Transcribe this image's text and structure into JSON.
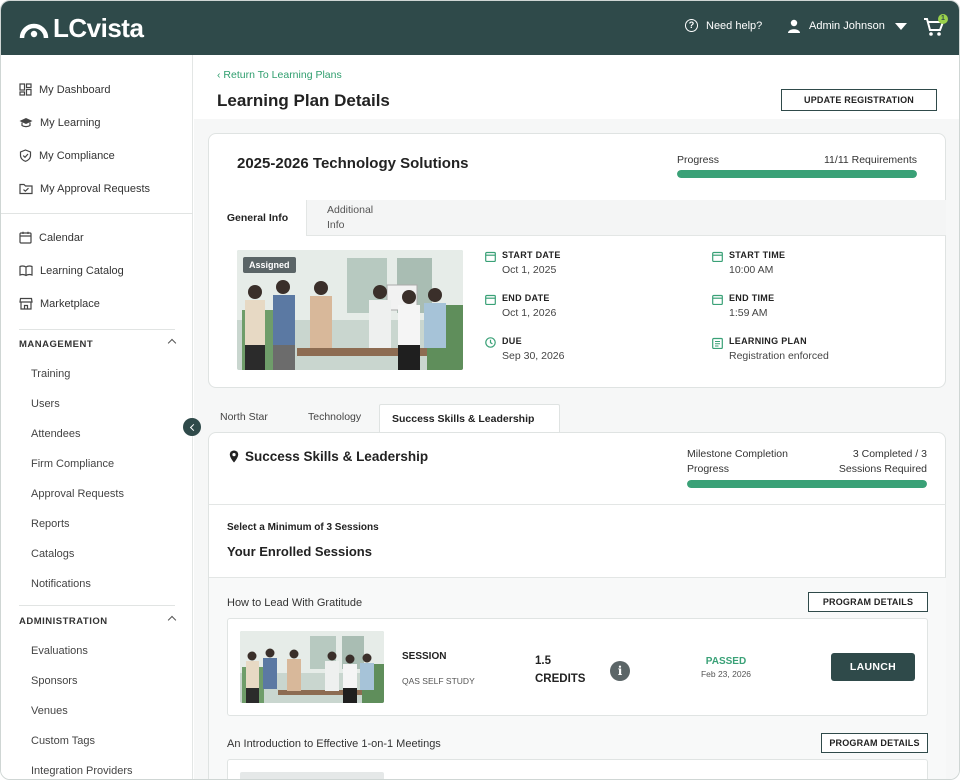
{
  "app": {
    "brand": "LCvista",
    "help_label": "Need help?",
    "user_name": "Admin Johnson",
    "cart_count": "1"
  },
  "sidebar": {
    "primary": [
      {
        "label": "My Dashboard",
        "icon": "dashboard-icon"
      },
      {
        "label": "My Learning",
        "icon": "graduation-cap-icon"
      },
      {
        "label": "My Compliance",
        "icon": "shield-check-icon"
      },
      {
        "label": "My Approval Requests",
        "icon": "folder-check-icon"
      }
    ],
    "secondary": [
      {
        "label": "Calendar",
        "icon": "calendar-icon"
      },
      {
        "label": "Learning Catalog",
        "icon": "book-open-icon"
      },
      {
        "label": "Marketplace",
        "icon": "store-icon"
      }
    ],
    "management": {
      "title": "MANAGEMENT",
      "items": [
        "Training",
        "Users",
        "Attendees",
        "Firm Compliance",
        "Approval Requests",
        "Reports",
        "Catalogs",
        "Notifications"
      ]
    },
    "administration": {
      "title": "ADMINISTRATION",
      "items": [
        "Evaluations",
        "Sponsors",
        "Venues",
        "Custom Tags",
        "Integration Providers"
      ]
    }
  },
  "page": {
    "back_link": "Return To Learning Plans",
    "title": "Learning Plan Details",
    "update_button": "UPDATE REGISTRATION"
  },
  "plan": {
    "title": "2025-2026 Technology Solutions",
    "progress_label": "Progress",
    "progress_text": "11/11 Requirements",
    "progress_fraction": 1.0,
    "tabs": [
      "General Info",
      "Additional Info"
    ],
    "badge": "Assigned",
    "fields": {
      "start_date": {
        "label": "START DATE",
        "value": "Oct 1, 2025"
      },
      "start_time": {
        "label": "START TIME",
        "value": "10:00 AM"
      },
      "end_date": {
        "label": "END DATE",
        "value": "Oct 1, 2026"
      },
      "end_time": {
        "label": "END TIME",
        "value": "1:59 AM"
      },
      "due": {
        "label": "DUE",
        "value": "Sep 30, 2026"
      },
      "learning_plan": {
        "label": "LEARNING PLAN",
        "value": "Registration enforced"
      }
    }
  },
  "path_tabs": [
    "North Star",
    "Technology",
    "Success Skills & Leadership"
  ],
  "milestone": {
    "title": "Success Skills & Leadership",
    "progress_label_1": "Milestone Completion",
    "progress_label_2": "Progress",
    "completed_1": "3 Completed / 3",
    "completed_2": "Sessions Required",
    "progress_fraction": 1.0,
    "min_sessions": "Select a Minimum of 3 Sessions",
    "enrolled_title": "Your Enrolled Sessions"
  },
  "sessions": [
    {
      "program": "How to Lead With Gratitude",
      "program_button": "PROGRAM DETAILS",
      "type": "SESSION",
      "format": "QAS SELF STUDY",
      "credits_value": "1.5",
      "credits_label": "CREDITS",
      "status": "PASSED",
      "status_date": "Feb 23, 2026",
      "action": "LAUNCH"
    },
    {
      "program": "An Introduction to Effective 1-on-1 Meetings",
      "program_button": "PROGRAM DETAILS"
    }
  ],
  "colors": {
    "brand_dark": "#2f4a4a",
    "accent_green": "#3aa177",
    "link_green": "#2f9e6e"
  }
}
